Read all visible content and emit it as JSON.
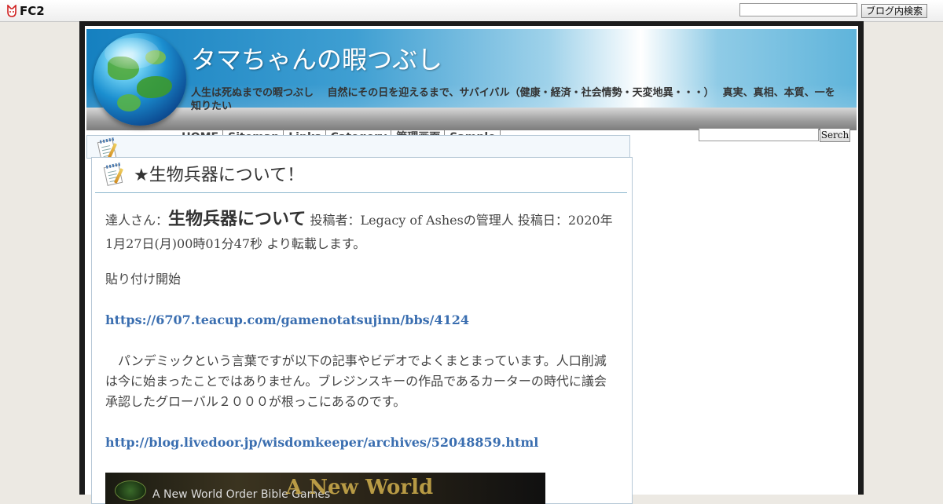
{
  "fc2": {
    "logo_text": "FC2",
    "search_placeholder": "",
    "search_button": "ブログ内検索"
  },
  "header": {
    "title": "タマちゃんの暇つぶし",
    "description": "人生は死ぬまでの暇つぶし　 自然にその日を迎えるまで、サバイバル（健康・経済・社会情勢・天変地異・・・）　 真実、真相、本質、一を知りたい"
  },
  "nav": {
    "items": [
      "HOME",
      "Sitemap",
      "Links",
      "Category",
      "管理画面",
      "Sample"
    ]
  },
  "sidebar": {
    "search_button": "Serch"
  },
  "entry": {
    "title": "★生物兵器について！",
    "intro_prefix": "達人さん：",
    "intro_big": "生物兵器について",
    "intro_rest": " 投稿者：Legacy of Ashesの管理人 投稿日：2020年 1月27日(月)00時01分47秒 より転載します。",
    "paste_start": "貼り付け開始",
    "link1": "https://6707.teacup.com/gamenotatsujinn/bbs/4124",
    "paragraph": "　パンデミックという言葉ですが以下の記事やビデオでよくまとまっています。人口削減は今に始まったことではありません。ブレジンスキーの作品であるカーターの時代に議会承認したグローバル２０００が根っこにあるのです。",
    "link2": "http://blog.livedoor.jp/wisdomkeeper/archives/52048859.html",
    "video": {
      "title_overlay": "A New World",
      "subtitle": "A New World Order Bible Games"
    }
  },
  "colors": {
    "link": "#3a6eb0",
    "frame": "#1c1c1c",
    "header_blue": "#1580c0",
    "entry_border": "#b6c8d6"
  },
  "icons": [
    "fc2-fox-icon",
    "globe-icon",
    "memo-icon",
    "clock-icon",
    "share-icon"
  ]
}
